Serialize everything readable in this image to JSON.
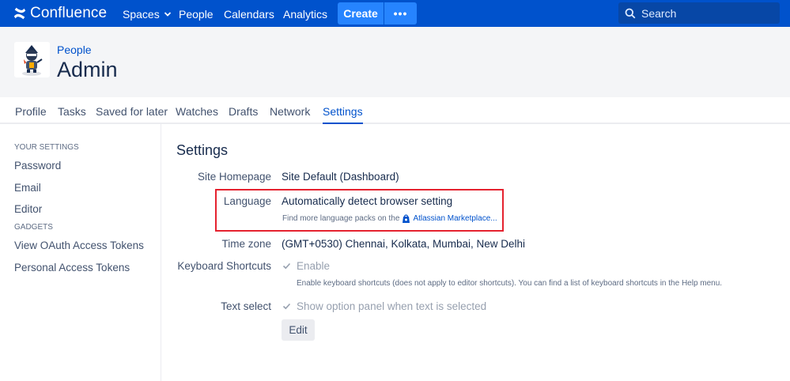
{
  "nav": {
    "logo_text": "Confluence",
    "items": [
      "Spaces",
      "People",
      "Calendars",
      "Analytics"
    ],
    "create_label": "Create",
    "more_label": "•••",
    "search_placeholder": "Search"
  },
  "header": {
    "breadcrumb": "People",
    "title": "Admin"
  },
  "tabs": [
    "Profile",
    "Tasks",
    "Saved for later",
    "Watches",
    "Drafts",
    "Network",
    "Settings"
  ],
  "active_tab": "Settings",
  "sidebar": {
    "your_settings_heading": "YOUR SETTINGS",
    "your_settings_items": [
      "Password",
      "Email",
      "Editor"
    ],
    "gadgets_heading": "GADGETS",
    "gadgets_items": [
      "View OAuth Access Tokens",
      "Personal Access Tokens"
    ]
  },
  "settings": {
    "title": "Settings",
    "site_homepage_label": "Site Homepage",
    "site_homepage_value": "Site Default (Dashboard)",
    "language_label": "Language",
    "language_value": "Automatically detect browser setting",
    "language_help_prefix": "Find more language packs on the",
    "language_help_link": "Atlassian Marketplace...",
    "timezone_label": "Time zone",
    "timezone_value": "(GMT+0530) Chennai, Kolkata, Mumbai, New Delhi",
    "shortcuts_label": "Keyboard Shortcuts",
    "shortcuts_value": "Enable",
    "shortcuts_checked": true,
    "shortcuts_desc": "Enable keyboard shortcuts (does not apply to editor shortcuts). You can find a list of keyboard shortcuts in the Help menu.",
    "text_select_label": "Text select",
    "text_select_value": "Show option panel when text is selected",
    "text_select_checked": true,
    "edit_button": "Edit"
  },
  "colors": {
    "nav_bg": "#0052cc",
    "accent": "#2684ff",
    "highlight_box": "#e5222f"
  }
}
